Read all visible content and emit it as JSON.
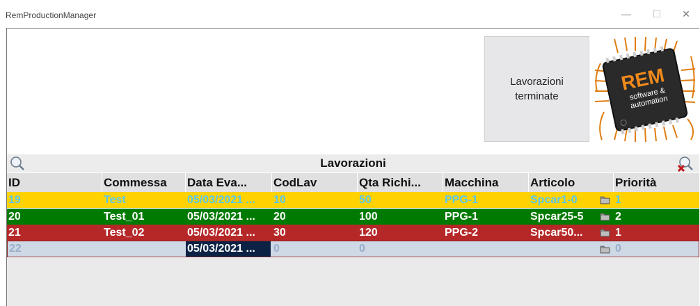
{
  "window": {
    "title": "RemProductionManager",
    "controls": {
      "minimize": "—",
      "maximize": "☐",
      "close": "✕"
    }
  },
  "toolbar": {
    "done_button_label": "Lavorazioni\nterminate"
  },
  "logo": {
    "brand": "REM",
    "tagline_1": "software &",
    "tagline_2": "automation"
  },
  "grid": {
    "title": "Lavorazioni",
    "columns": [
      "ID",
      "Commessa",
      "Data Eva...",
      "CodLav",
      "Qta Richi...",
      "Macchina",
      "Articolo",
      "",
      "Priorità"
    ],
    "rows": [
      {
        "id": "19",
        "commessa": "Test",
        "data": "05/03/2021 ...",
        "codlav": "10",
        "qta": "50",
        "macchina": "PPG-1",
        "articolo": "Spcar1-0",
        "priorita": "1",
        "color": "#ffd200"
      },
      {
        "id": "20",
        "commessa": "Test_01",
        "data": "05/03/2021 ...",
        "codlav": "20",
        "qta": "100",
        "macchina": "PPG-1",
        "articolo": "Spcar25-5",
        "priorita": "2",
        "color": "#007a00"
      },
      {
        "id": "21",
        "commessa": "Test_02",
        "data": "05/03/2021 ...",
        "codlav": "30",
        "qta": "120",
        "macchina": "PPG-2",
        "articolo": "Spcar50...",
        "priorita": "1",
        "color": "#b62828"
      },
      {
        "id": "22",
        "commessa": "",
        "data": "05/03/2021 ...",
        "codlav": "0",
        "qta": "0",
        "macchina": "",
        "articolo": "",
        "priorita": "0",
        "color": "#cfd8e5"
      }
    ]
  },
  "colors": {
    "accent_orange": "#e06a10",
    "header_bg": "#e0e0e0",
    "selection": "#0b2245"
  }
}
